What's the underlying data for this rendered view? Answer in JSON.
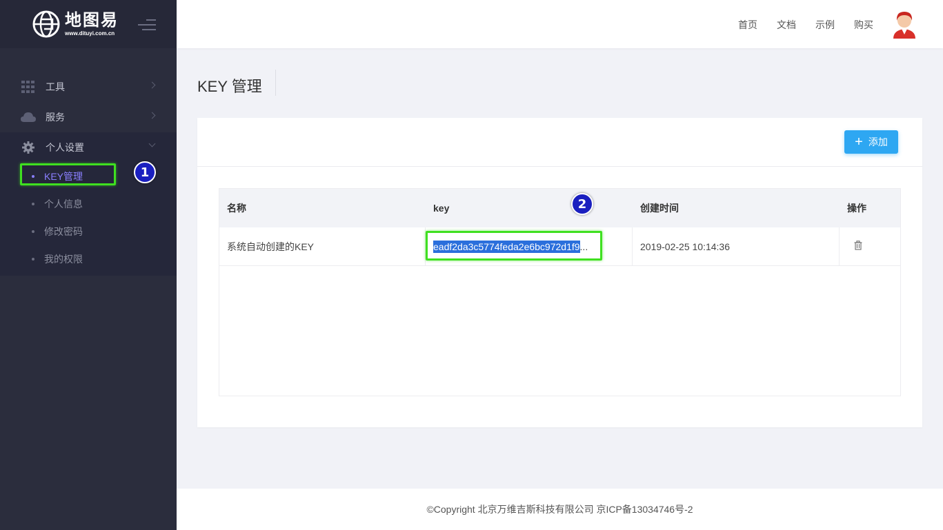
{
  "logo": {
    "name": "地图易",
    "url": "www.dituyi.com.cn"
  },
  "sidebar": {
    "menu": [
      {
        "label": "工具",
        "icon": "grid-icon"
      },
      {
        "label": "服务",
        "icon": "cloud-icon"
      },
      {
        "label": "个人设置",
        "icon": "gear-icon"
      }
    ],
    "submenu": [
      {
        "label": "KEY管理",
        "active": true
      },
      {
        "label": "个人信息"
      },
      {
        "label": "修改密码"
      },
      {
        "label": "我的权限"
      }
    ]
  },
  "header": {
    "nav": [
      "首页",
      "文档",
      "示例",
      "购买"
    ]
  },
  "page": {
    "title": "KEY 管理",
    "add_button": "添加"
  },
  "table": {
    "columns": [
      "名称",
      "key",
      "创建时间",
      "操作"
    ],
    "rows": [
      {
        "name": "系统自动创建的KEY",
        "key_selected": "eadf2da3c5774feda2e6bc972d1f9",
        "key_ellipsis": "...",
        "created": "2019-02-25 10:14:36"
      }
    ]
  },
  "annotations": {
    "badge_1": "1",
    "badge_2": "2"
  },
  "footer": {
    "text": "©Copyright 北京万维吉斯科技有限公司 京ICP备13034746号-2"
  },
  "colors": {
    "sidebar_bg": "#2b2d3d",
    "accent_active": "#8a7fff",
    "add_button": "#2ea7f2",
    "highlight_box": "#3fe020",
    "badge": "#1a1fbf"
  }
}
